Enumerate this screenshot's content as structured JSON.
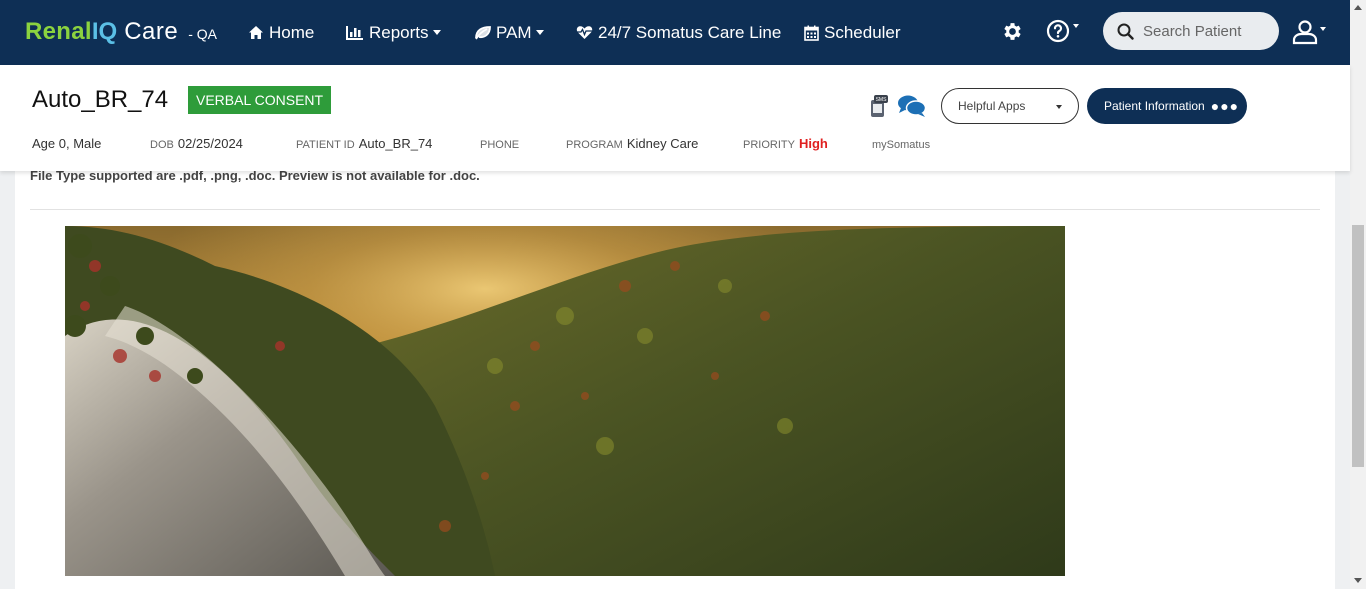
{
  "app": {
    "brand_renal": "Renal",
    "brand_iq": "IQ",
    "brand_care": "Care",
    "env": "- QA"
  },
  "nav": {
    "home": "Home",
    "reports": "Reports",
    "pam": "PAM",
    "care_line": "24/7 Somatus Care Line",
    "scheduler": "Scheduler",
    "search_placeholder": "Search Patient"
  },
  "patient": {
    "name": "Auto_BR_74",
    "consent": "VERBAL CONSENT",
    "age_sex": "Age 0, Male",
    "dob_label": "DOB",
    "dob": "02/25/2024",
    "patient_id_label": "PATIENT ID",
    "patient_id": "Auto_BR_74",
    "phone_label": "PHONE",
    "phone": "",
    "program_label": "PROGRAM",
    "program": "Kidney Care",
    "priority_label": "PRIORITY",
    "priority": "High",
    "my_somatus": "mySomatus"
  },
  "header_actions": {
    "helpful_apps": "Helpful Apps",
    "patient_info": "Patient Information",
    "sms_icon_text": "SMS"
  },
  "content": {
    "file_note": "File Type supported are .pdf, .png, .doc. Preview is not available for .doc."
  },
  "colors": {
    "navbar": "#0e2f55",
    "brand_green": "#8bd33f",
    "brand_blue": "#5bc0e6",
    "consent_green": "#2e9c3a",
    "priority_red": "#e02020"
  },
  "icons": [
    "home-icon",
    "bar-chart-icon",
    "leaf-icon",
    "heartbeat-icon",
    "calendar-icon",
    "gear-icon",
    "help-icon",
    "search-icon",
    "user-icon",
    "sms-phone-icon",
    "chat-icon"
  ]
}
